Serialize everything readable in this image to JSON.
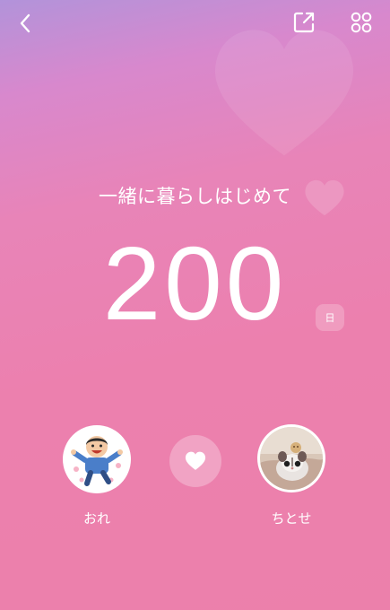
{
  "header": {
    "back_icon": "chevron-left-icon",
    "share_icon": "share-export-icon",
    "menu_icon": "grid-menu-icon"
  },
  "main": {
    "title": "一緒に暮らしはじめて",
    "day_count": "200",
    "day_unit": "日"
  },
  "couple": {
    "left": {
      "name": "おれ",
      "avatar_icon": "cartoon-boy-avatar"
    },
    "right": {
      "name": "ちとせ",
      "avatar_icon": "sugar-glider-photo-avatar"
    },
    "center_icon": "heart-icon"
  },
  "colors": {
    "gradient_top": "#b293da",
    "gradient_bottom": "#ec80ab",
    "text": "#ffffff"
  }
}
